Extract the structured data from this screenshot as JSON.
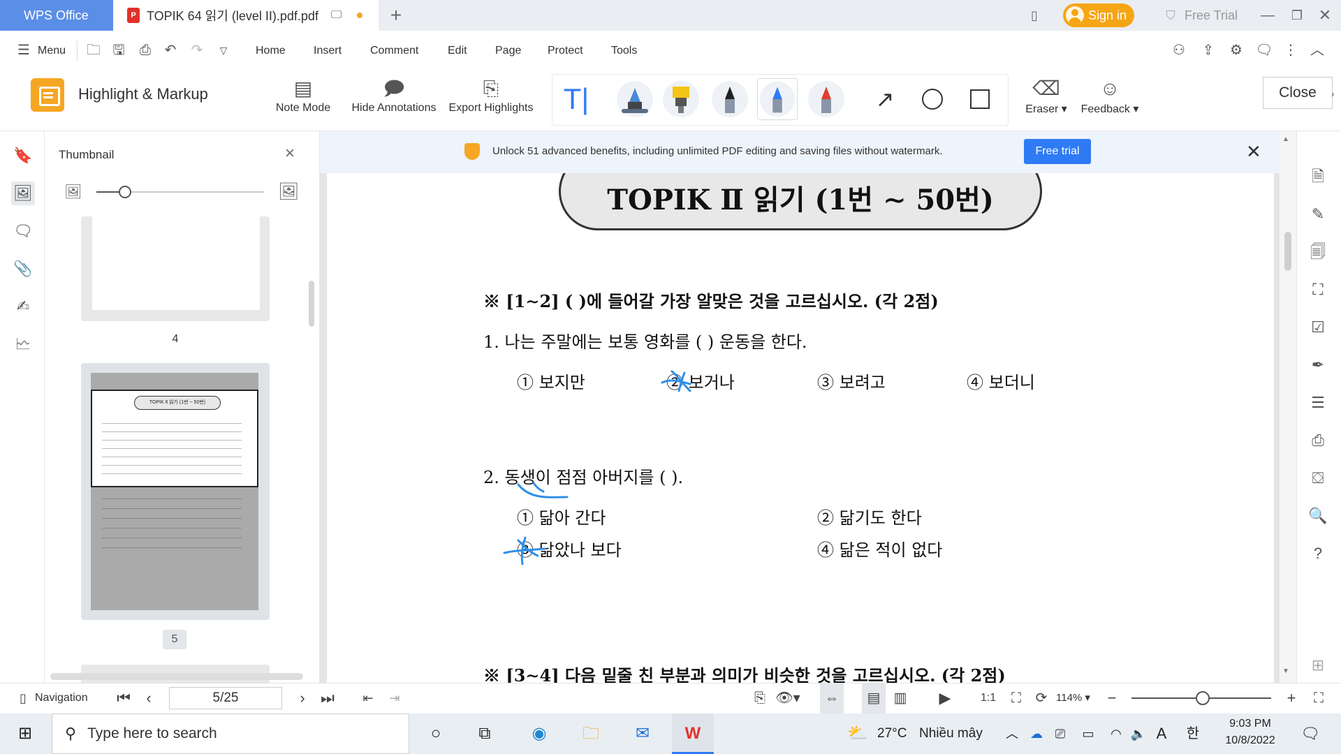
{
  "titlebar": {
    "app_name": "WPS Office",
    "doc_tab": "TOPIK 64 읽기 (level II).pdf.pdf",
    "new_tab": "+",
    "sign_in": "Sign in",
    "free_trial": "Free Trial"
  },
  "menu": {
    "menu_label": "Menu",
    "tabs": [
      "Home",
      "Insert",
      "Comment",
      "Edit",
      "Page",
      "Protect",
      "Tools"
    ]
  },
  "ribbon": {
    "title": "Highlight & Markup",
    "note_mode": "Note Mode",
    "hide_annotations": "Hide Annotations",
    "export_highlights": "Export Highlights",
    "eraser": "Eraser",
    "feedback": "Feedback",
    "close": "Close",
    "accent": "#f5a623"
  },
  "thumbnail": {
    "title": "Thumbnail",
    "pages": [
      "4",
      "5"
    ],
    "mini_title": "TOPIK Ⅱ 읽기 (1번 ~ 50번)"
  },
  "banner": {
    "text": "Unlock 51 advanced benefits, including unlimited PDF editing and saving files without watermark.",
    "button": "Free trial"
  },
  "document": {
    "title": "TOPIK Ⅱ 읽기 (1번 ∼ 50번)",
    "section1": "※  [1∼2] (             )에 들어갈 가장 알맞은 것을 고르십시오. (각 2점)",
    "q1": "1.   나는 주말에는 보통 영화를 (            ) 운동을 한다.",
    "q1_options": [
      "① 보지만",
      "② 보거나",
      "③ 보려고",
      "④ 보더니"
    ],
    "q2": "2.   동생이 점점 아버지를 (            ).",
    "q2_options": [
      "① 닮아 간다",
      "② 닮기도 한다",
      "③ 닮았나 보다",
      "④ 닮은 적이 없다"
    ],
    "section2": "※  [3∼4] 다음 밑줄 친 부분과 의미가 비슷한 것을 고르십시오. (각 2점)",
    "ink_color": "#2f8fe8"
  },
  "status": {
    "navigation": "Navigation",
    "page": "5/25",
    "zoom": "114%"
  },
  "taskbar": {
    "search_placeholder": "Type here to search",
    "weather_temp": "27°C",
    "weather_text": "Nhiều mây",
    "lang_a": "A",
    "lang_ko": "한",
    "time": "9:03 PM",
    "date": "10/8/2022"
  }
}
